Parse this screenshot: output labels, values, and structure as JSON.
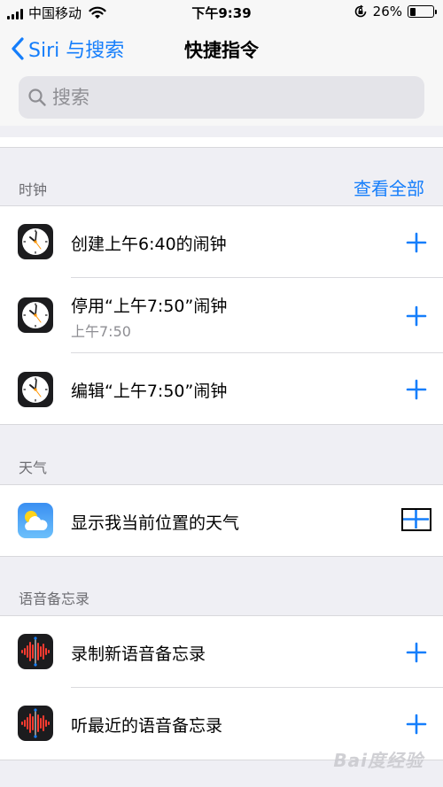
{
  "status_bar": {
    "carrier": "中国移动",
    "time": "下午9:39",
    "battery": "26%",
    "battery_level": 0.26
  },
  "nav": {
    "back_label": "Siri 与搜索",
    "title": "快捷指令"
  },
  "search": {
    "placeholder": "搜索"
  },
  "sections": {
    "clock": {
      "title": "时钟",
      "link": "查看全部",
      "items": [
        {
          "title": "创建上午6:40的闹钟"
        },
        {
          "title": "停用“上午7:50”闹钟",
          "subtitle": "上午7:50"
        },
        {
          "title": "编辑“上午7:50”闹钟"
        }
      ]
    },
    "weather": {
      "title": "天气",
      "items": [
        {
          "title": "显示我当前位置的天气"
        }
      ]
    },
    "voice_memos": {
      "title": "语音备忘录",
      "items": [
        {
          "title": "录制新语音备忘录"
        },
        {
          "title": "听最近的语音备忘录"
        }
      ]
    }
  },
  "watermark": "Bai度经验",
  "colors": {
    "accent": "#157efb",
    "background": "#efeff4",
    "secondary_text": "#6d6d72"
  },
  "icons": [
    "wifi-icon",
    "lock-rotation-icon",
    "chevron-left-icon",
    "search-icon",
    "clock-app-icon",
    "weather-app-icon",
    "voice-memos-app-icon",
    "plus-icon"
  ]
}
